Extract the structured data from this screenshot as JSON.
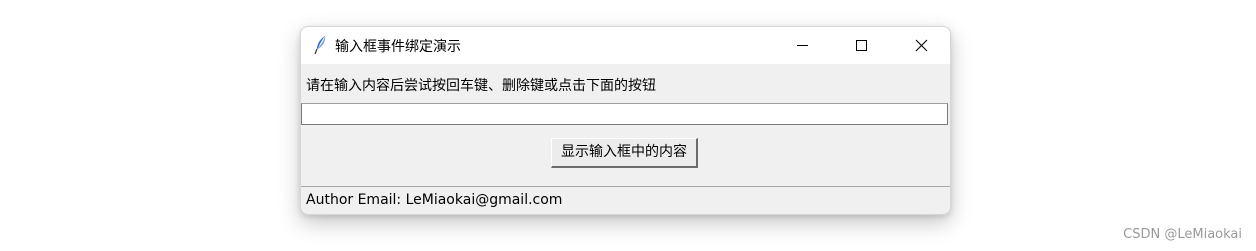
{
  "window": {
    "title": "输入框事件绑定演示",
    "app_icon": "feather-icon",
    "controls": {
      "minimize_icon": "minimize-icon",
      "maximize_icon": "maximize-icon",
      "close_icon": "close-icon"
    }
  },
  "main": {
    "instruction_label": "请在输入内容后尝试按回车键、删除键或点击下面的按钮",
    "entry_value": "",
    "show_button_label": "显示输入框中的内容",
    "author_label": "Author Email: LeMiaokai@gmail.com"
  },
  "watermark": "CSDN @LeMiaokai",
  "colors": {
    "titlebar_bg": "#ffffff",
    "window_bg": "#f0f0f0",
    "icon_blue": "#3a6fc4"
  }
}
